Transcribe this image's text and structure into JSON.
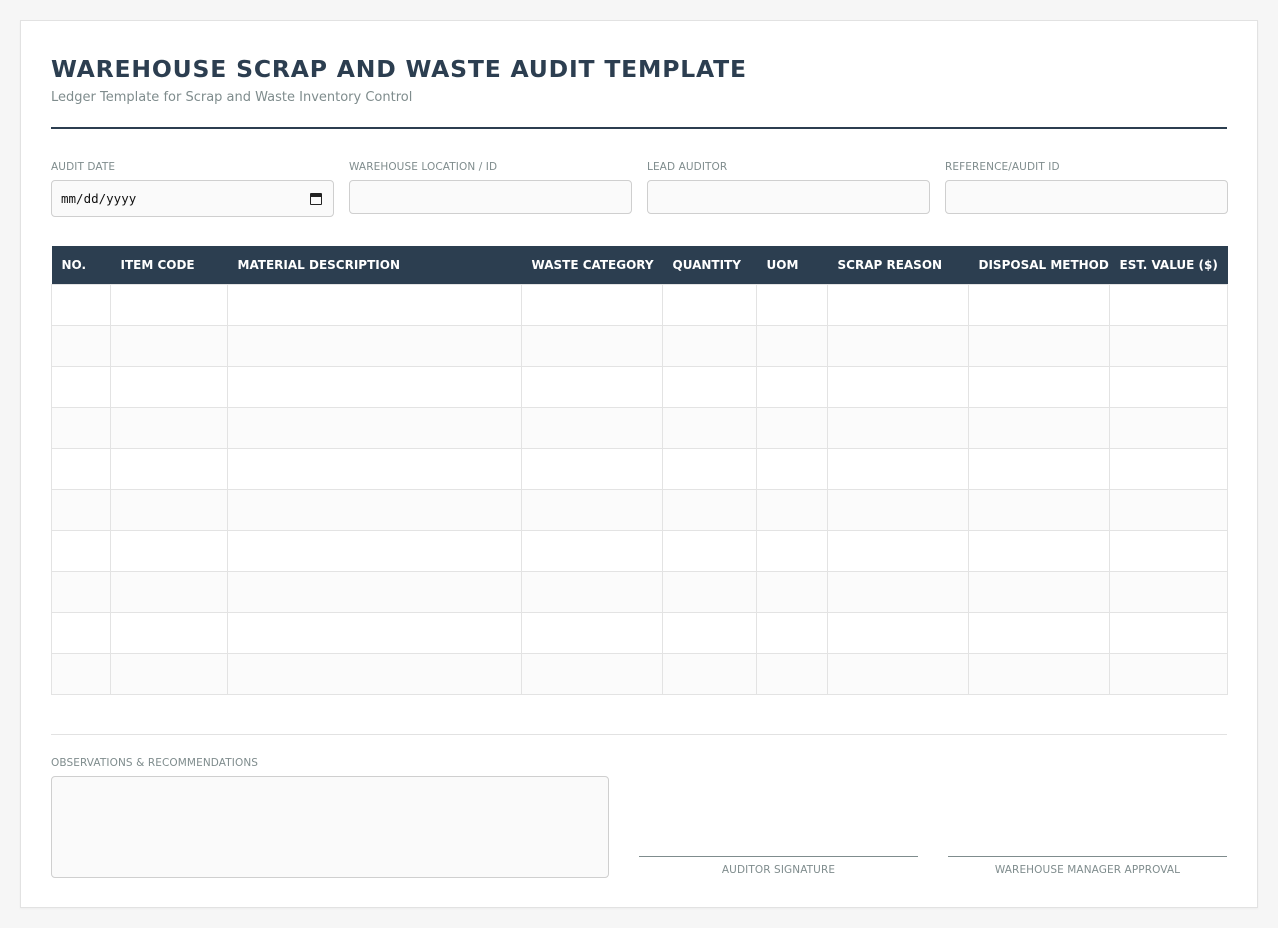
{
  "header": {
    "title": "WAREHOUSE SCRAP AND WASTE AUDIT TEMPLATE",
    "subtitle": "Ledger Template for Scrap and Waste Inventory Control"
  },
  "fields": {
    "audit_date": {
      "label": "AUDIT DATE",
      "placeholder": "mm/dd/yyyy"
    },
    "warehouse_location": {
      "label": "WAREHOUSE LOCATION / ID",
      "value": ""
    },
    "lead_auditor": {
      "label": "LEAD AUDITOR",
      "value": ""
    },
    "reference_id": {
      "label": "REFERENCE/AUDIT ID",
      "value": ""
    }
  },
  "table": {
    "columns": [
      "NO.",
      "ITEM CODE",
      "MATERIAL DESCRIPTION",
      "WASTE CATEGORY",
      "QUANTITY",
      "UOM",
      "SCRAP REASON",
      "DISPOSAL METHOD",
      "EST. VALUE ($)"
    ],
    "rows": [
      [
        "",
        "",
        "",
        "",
        "",
        "",
        "",
        "",
        ""
      ],
      [
        "",
        "",
        "",
        "",
        "",
        "",
        "",
        "",
        ""
      ],
      [
        "",
        "",
        "",
        "",
        "",
        "",
        "",
        "",
        ""
      ],
      [
        "",
        "",
        "",
        "",
        "",
        "",
        "",
        "",
        ""
      ],
      [
        "",
        "",
        "",
        "",
        "",
        "",
        "",
        "",
        ""
      ],
      [
        "",
        "",
        "",
        "",
        "",
        "",
        "",
        "",
        ""
      ],
      [
        "",
        "",
        "",
        "",
        "",
        "",
        "",
        "",
        ""
      ],
      [
        "",
        "",
        "",
        "",
        "",
        "",
        "",
        "",
        ""
      ],
      [
        "",
        "",
        "",
        "",
        "",
        "",
        "",
        "",
        ""
      ],
      [
        "",
        "",
        "",
        "",
        "",
        "",
        "",
        "",
        ""
      ]
    ]
  },
  "observations": {
    "label": "OBSERVATIONS & RECOMMENDATIONS",
    "value": ""
  },
  "signatures": {
    "auditor": "AUDITOR SIGNATURE",
    "manager": "WAREHOUSE MANAGER APPROVAL"
  },
  "colors": {
    "header_dark": "#2c3e50",
    "muted_text": "#7f8c8d",
    "border": "#cfcfcf"
  },
  "icons": {
    "date_picker": "calendar-icon"
  }
}
